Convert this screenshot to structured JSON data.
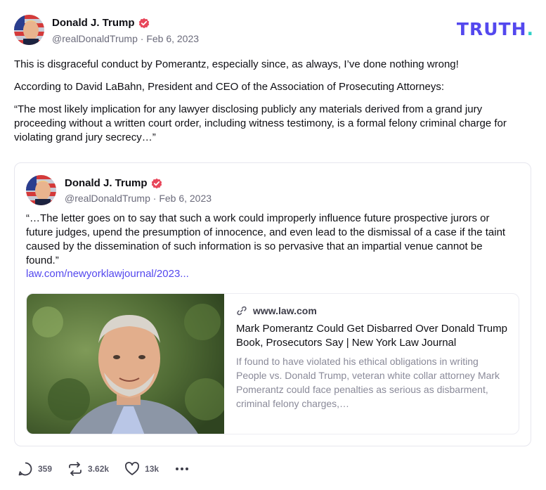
{
  "post": {
    "author_name": "Donald J. Trump",
    "handle": "@realDonaldTrump",
    "separator": "·",
    "date": "Feb 6, 2023",
    "brand_text": "TRUTH",
    "brand_dot": ".",
    "paragraphs": [
      "This is disgraceful conduct by Pomerantz, especially since, as always, I’ve done nothing wrong!",
      "According to David LaBahn, President and CEO of the Association of Prosecuting Attorneys:",
      "“The most likely implication for any lawyer disclosing publicly any materials derived from a grand jury proceeding without a written court order, including witness testimony, is a formal felony criminal charge for violating grand jury secrecy…”"
    ]
  },
  "quoted": {
    "author_name": "Donald J. Trump",
    "handle": "@realDonaldTrump",
    "separator": "·",
    "date": "Feb 6, 2023",
    "text": "“…The letter goes on to say that such a work could improperly influence future prospective jurors or future judges, upend the presumption of innocence, and even lead to the dismissal of a case if the taint caused by the dissemination of such information is so pervasive that an impartial venue cannot be found.”",
    "link_text": "law.com/newyorklawjournal/2023..."
  },
  "card": {
    "domain": "www.law.com",
    "title": "Mark Pomerantz Could Get Disbarred Over Donald Trump Book, Prosecutors Say | New York Law Journal",
    "description": "If found to have violated his ethical obligations in writing People vs. Donald Trump, veteran white collar attorney Mark Pomerantz could face penalties as serious as disbarment, criminal felony charges,…"
  },
  "actions": {
    "replies": "359",
    "retruths": "3.62k",
    "likes": "13k"
  },
  "icons": {
    "verified": "verified-badge-icon",
    "link": "link-icon",
    "reply": "reply-icon",
    "retruth": "retruth-icon",
    "like": "heart-icon",
    "more": "more-icon"
  },
  "colors": {
    "brand": "#5448ee",
    "brand_accent": "#2fd1c7",
    "verified": "#e8465a",
    "link": "#5448ee"
  }
}
